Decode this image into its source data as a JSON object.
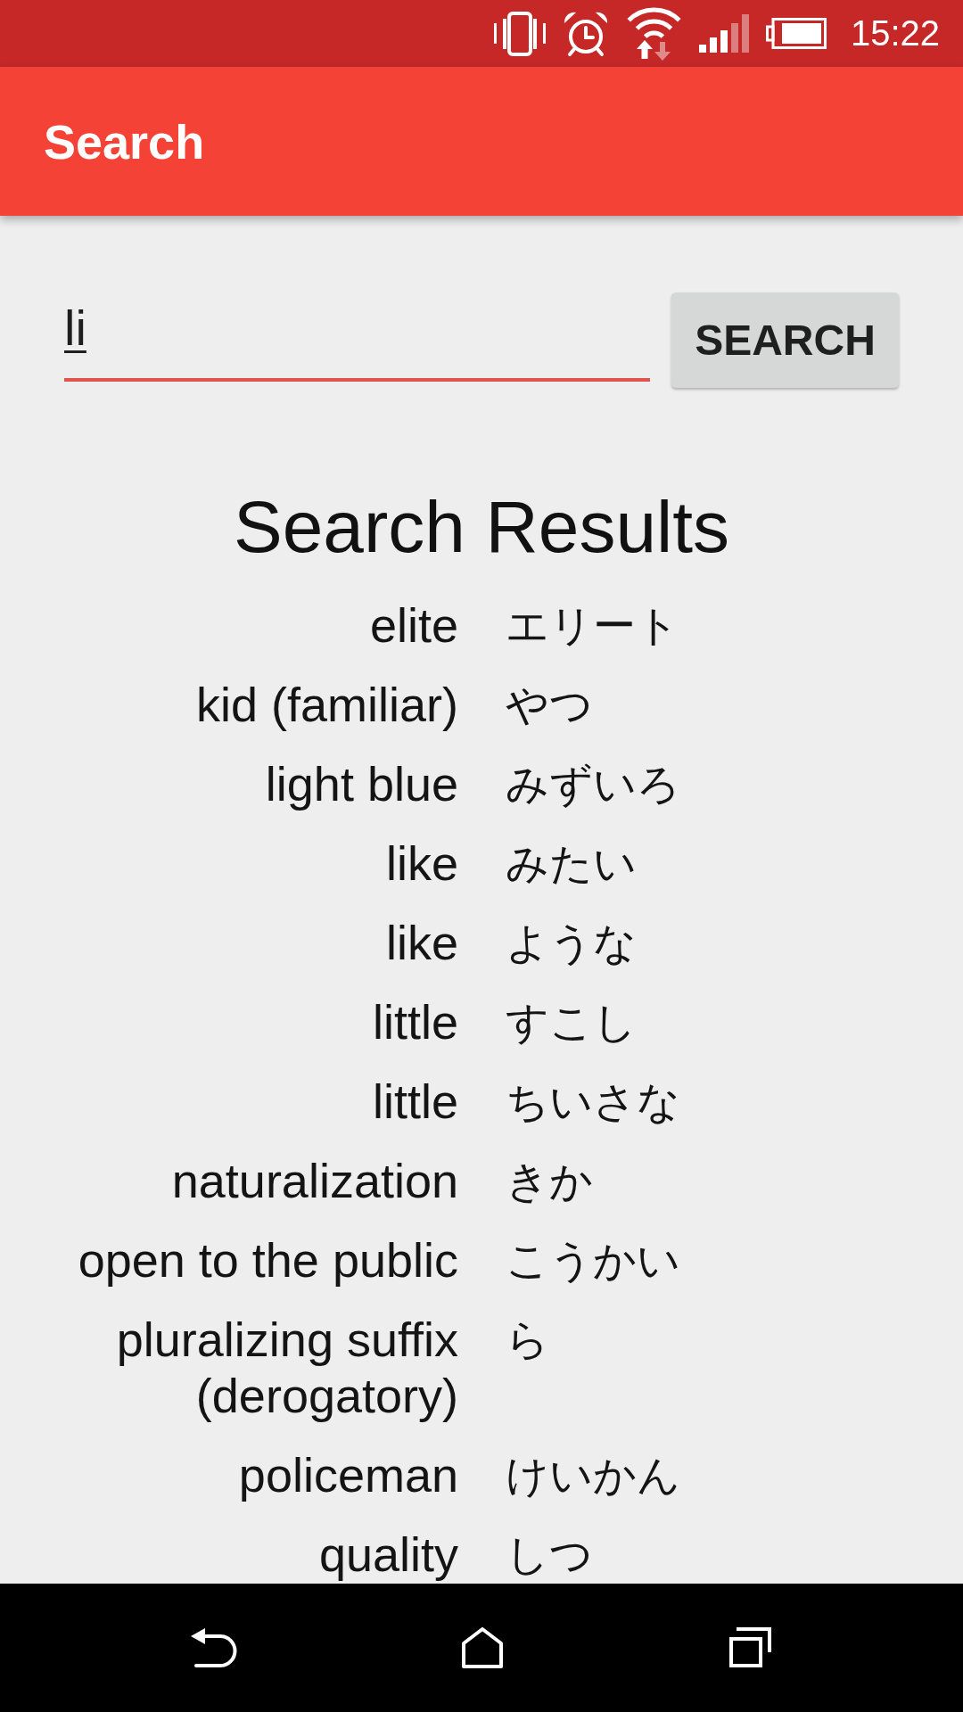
{
  "status_bar": {
    "time": "15:22"
  },
  "app_bar": {
    "title": "Search"
  },
  "search": {
    "value": "li",
    "button": "SEARCH"
  },
  "results": {
    "title": "Search Results",
    "rows": [
      {
        "english": "elite",
        "japanese": "エリート"
      },
      {
        "english": "kid (familiar)",
        "japanese": "やつ"
      },
      {
        "english": "light blue",
        "japanese": "みずいろ"
      },
      {
        "english": "like",
        "japanese": "みたい"
      },
      {
        "english": "like",
        "japanese": "ような"
      },
      {
        "english": "little",
        "japanese": "すこし"
      },
      {
        "english": "little",
        "japanese": "ちいさな"
      },
      {
        "english": "naturalization",
        "japanese": "きか"
      },
      {
        "english": "open to the public",
        "japanese": "こうかい"
      },
      {
        "english": "pluralizing suffix (derogatory)",
        "japanese": "ら"
      },
      {
        "english": "policeman",
        "japanese": "けいかん"
      },
      {
        "english": "quality",
        "japanese": "しつ"
      }
    ]
  }
}
